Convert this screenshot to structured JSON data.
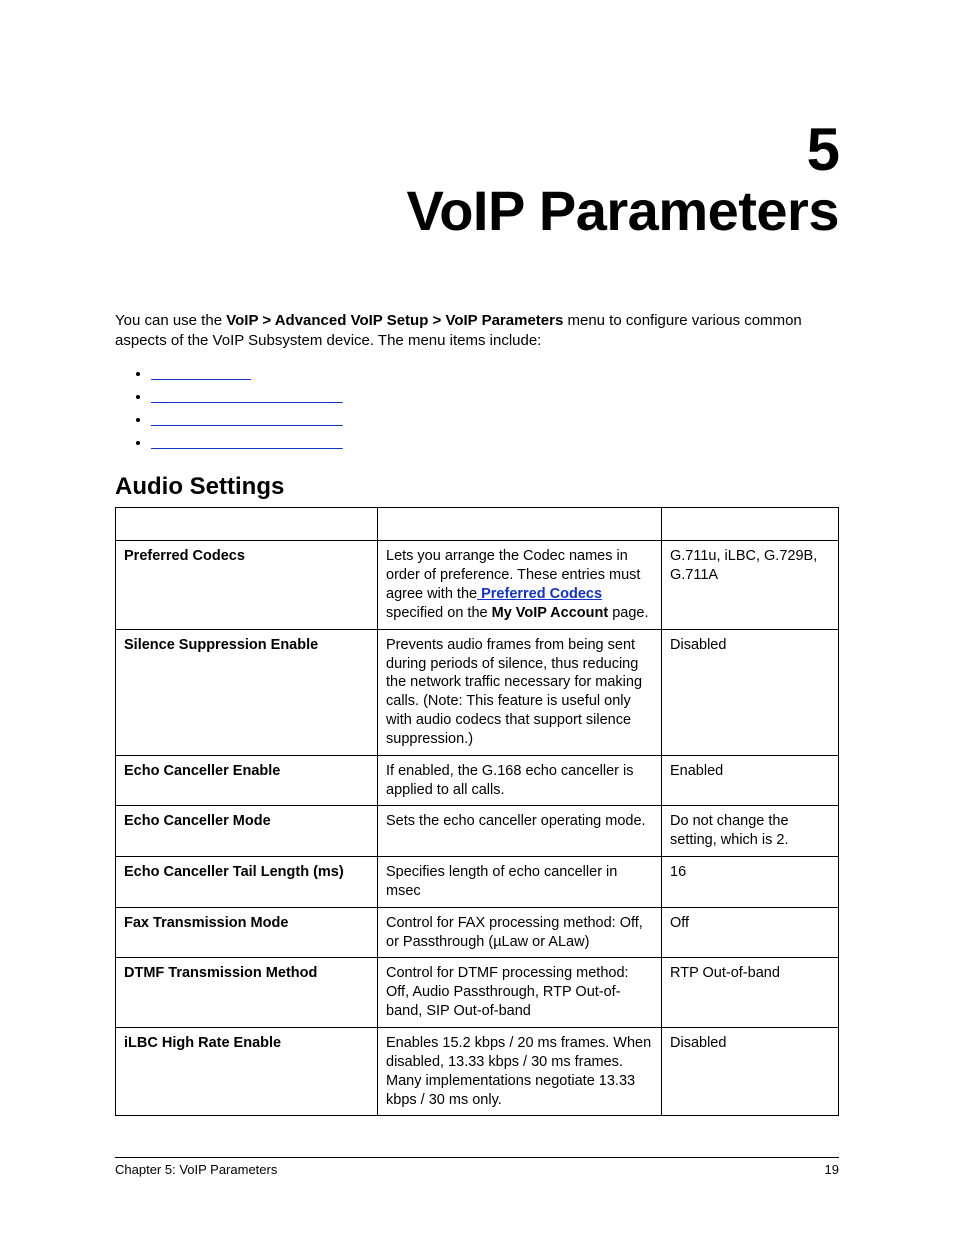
{
  "chapter": {
    "number": "5",
    "title": "VoIP Parameters"
  },
  "intro": {
    "pre": "You can use the ",
    "bold": "VoIP > Advanced VoIP Setup > VoIP Parameters",
    "post": " menu to configure various common aspects of the VoIP Subsystem device. The menu items include:"
  },
  "toc": [
    "",
    "",
    "",
    ""
  ],
  "section_heading": "Audio Settings",
  "table_headers": [
    "",
    "",
    ""
  ],
  "rows": [
    {
      "name": "Preferred Codecs",
      "desc_pre": "Lets you arrange the Codec names in order of preference. These entries must agree with the",
      "desc_link": " Preferred Codecs ",
      "desc_mid": "specified on the ",
      "desc_bold": "My VoIP Account",
      "desc_post": " page.",
      "default": "G.711u, iLBC, G.729B, G.711A"
    },
    {
      "name": "Silence Suppression Enable",
      "desc": "Prevents audio frames from being sent during periods of silence, thus reducing the network traffic necessary for making calls. (Note: This feature is useful only with audio codecs that support silence suppression.)",
      "default": "Disabled"
    },
    {
      "name": "Echo Canceller Enable",
      "desc": "If enabled, the G.168 echo canceller is applied to all calls.",
      "default": "Enabled"
    },
    {
      "name": "Echo Canceller Mode",
      "desc": "Sets the echo canceller operating mode.",
      "default": "Do not change the setting, which is 2."
    },
    {
      "name": "Echo Canceller Tail Length (ms)",
      "desc": "Specifies length of echo canceller in msec",
      "default": "16"
    },
    {
      "name": "Fax Transmission Mode",
      "desc": "Control for FAX processing method: Off, or Passthrough (µLaw or ALaw)",
      "default": "Off"
    },
    {
      "name": "DTMF Transmission Method",
      "desc": "Control for DTMF processing method: Off, Audio Passthrough, RTP Out-of-band, SIP Out-of-band",
      "default": "RTP Out-of-band"
    },
    {
      "name": "iLBC High Rate Enable",
      "desc": "Enables 15.2 kbps / 20 ms frames. When disabled, 13.33 kbps / 30 ms frames. Many implementations negotiate 13.33 kbps / 30 ms only.",
      "default": "Disabled"
    }
  ],
  "footer": {
    "left": "Chapter 5:  VoIP Parameters",
    "right": "19"
  }
}
